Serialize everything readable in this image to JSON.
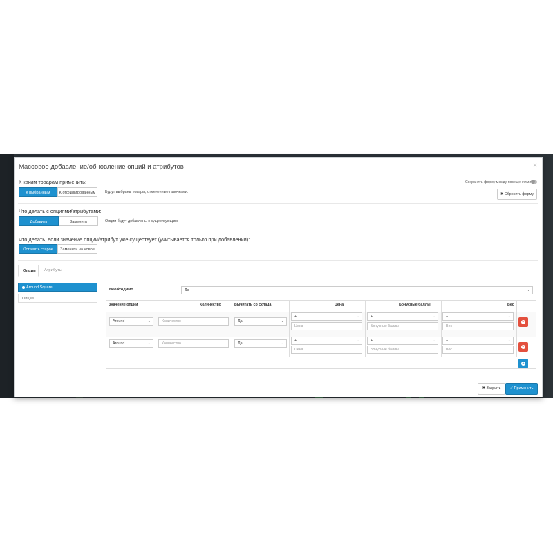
{
  "modal": {
    "title": "Массовое добавление/обновление опций и атрибутов",
    "close_icon": "×"
  },
  "apply_to": {
    "label": "К каким товарам применить:",
    "options": [
      "К выбранным",
      "К отфильтрованным"
    ],
    "selected": "К выбранным",
    "hint": "Будут выбраны товары, отмеченные галочками."
  },
  "save_form": {
    "label": "Сохранять форму между посещениями",
    "reset_button": "✖ Сбросить форму"
  },
  "action": {
    "label": "Что делать с опциями/атрибутами:",
    "options": [
      "Добавить",
      "Заменить"
    ],
    "selected": "Добавить",
    "hint": "Опции будут добавлены к существующим."
  },
  "exists": {
    "label": "Что делать, если значение опции/атрибут уже существует (учитывается только при добавлении):",
    "options": [
      "Оставить старое",
      "Заменить на новое"
    ],
    "selected": "Оставить старое"
  },
  "tabs": [
    {
      "label": "Опции",
      "active": true
    },
    {
      "label": "Атрибуты",
      "active": false
    }
  ],
  "options_list": {
    "selected_item": "Around Square",
    "placeholder_item": "Опция"
  },
  "required": {
    "label": "Необходимо",
    "value": "Да"
  },
  "table": {
    "headers": {
      "option_value": "Значение опции",
      "quantity": "Количество",
      "subtract": "Вычитать со склада",
      "price": "Цена",
      "points": "Бонусные баллы",
      "weight": "Вес"
    },
    "rows": [
      {
        "option_value": "Around",
        "quantity_placeholder": "Количество",
        "subtract": "Да",
        "price_prefix": "+",
        "price_placeholder": "Цена",
        "points_prefix": "+",
        "points_placeholder": "Бонусные баллы",
        "weight_prefix": "+",
        "weight_placeholder": "Вес"
      },
      {
        "option_value": "Around",
        "quantity_placeholder": "Количество",
        "subtract": "Да",
        "price_prefix": "+",
        "price_placeholder": "Цена",
        "points_prefix": "+",
        "points_placeholder": "Бонусные баллы",
        "weight_prefix": "+",
        "weight_placeholder": "Вес"
      }
    ]
  },
  "footer": {
    "close_button": "✖ Закрыть",
    "apply_button": "✔ Применить"
  },
  "colors": {
    "primary": "#1e91cf",
    "danger": "#e3503e",
    "backdrop": "#2b3237"
  },
  "icons": [
    "close-icon",
    "remove-icon",
    "add-icon",
    "check-icon",
    "chevron-down-icon",
    "toggle-icon"
  ]
}
